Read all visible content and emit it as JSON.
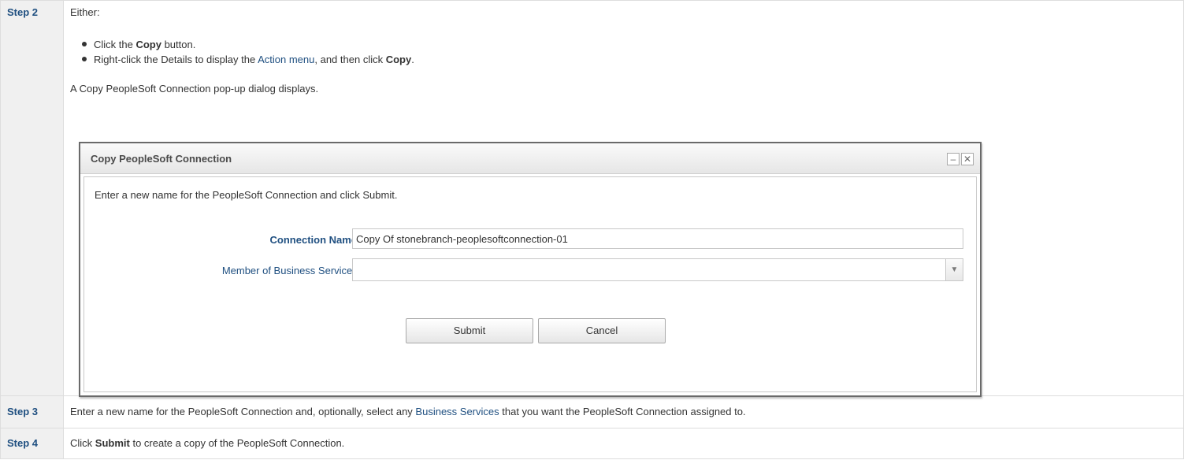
{
  "steps": [
    {
      "label": "Step 2",
      "intro": "Either:",
      "bullets": [
        {
          "pre": "Click the ",
          "bold": "Copy",
          "post": " button."
        },
        {
          "pre": "Right-click the Details to display the ",
          "link": "Action menu",
          "mid": ", and then click ",
          "bold": "Copy",
          "post": "."
        }
      ],
      "result": "A Copy PeopleSoft Connection pop-up dialog displays."
    },
    {
      "label": "Step 3",
      "pre": "Enter a new name for the PeopleSoft Connection and, optionally, select any ",
      "link": "Business Services",
      "post": " that you want the PeopleSoft Connection assigned to."
    },
    {
      "label": "Step 4",
      "pre": "Click ",
      "bold": "Submit",
      "post": " to create a copy of the PeopleSoft Connection."
    }
  ],
  "dialog": {
    "title": "Copy PeopleSoft Connection",
    "minimize_glyph": "–",
    "close_glyph": "✕",
    "intro": "Enter a new name for the PeopleSoft Connection and click Submit.",
    "fields": {
      "connection_name_label": "Connection Name :",
      "connection_name_value": "Copy Of stonebranch-peoplesoftconnection-01",
      "member_label": "Member of Business Services :",
      "member_value": ""
    },
    "buttons": {
      "submit": "Submit",
      "cancel": "Cancel"
    }
  },
  "colors": {
    "link": "#205081",
    "label_bg": "#f0f0f0"
  },
  "icons": {
    "bullet": "bullet-dot-icon",
    "dropdown": "chevron-down-icon",
    "minimize": "minimize-icon",
    "close": "close-icon"
  }
}
